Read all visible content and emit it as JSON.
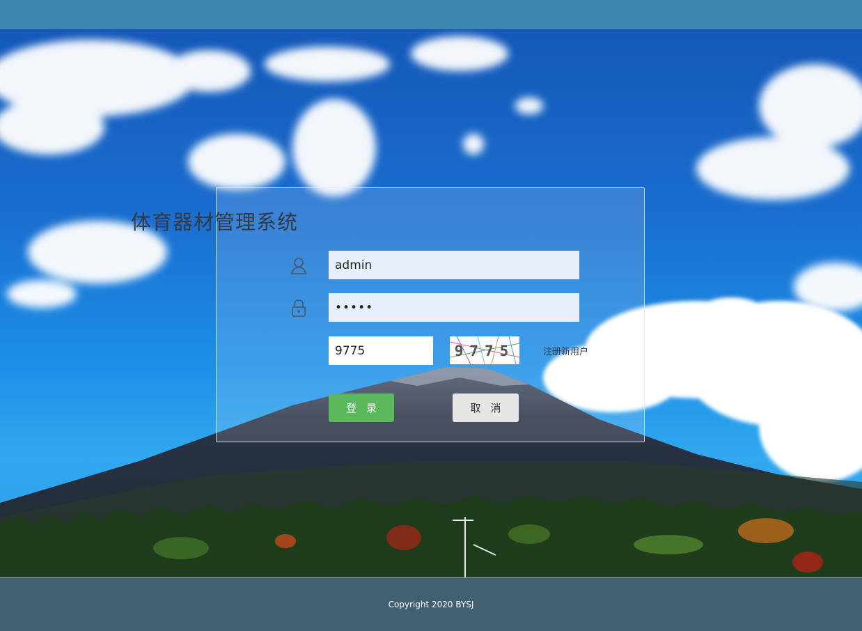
{
  "login": {
    "title": "体育器材管理系统",
    "username_value": "admin",
    "password_value": "•••••",
    "captcha_input_value": "9775",
    "captcha_image_text": "9775",
    "register_link": "注册新用户",
    "login_button": "登录",
    "cancel_button": "取消"
  },
  "icons": {
    "username": "user-icon",
    "password": "lock-icon"
  },
  "colors": {
    "header": "#3a86b0",
    "footer": "#416173",
    "login_button": "#5cb85c",
    "cancel_button": "#e6e6e6",
    "input_autofill": "#e8f0fe"
  },
  "footer": {
    "copyright": "Copyright 2020 BYSJ"
  }
}
